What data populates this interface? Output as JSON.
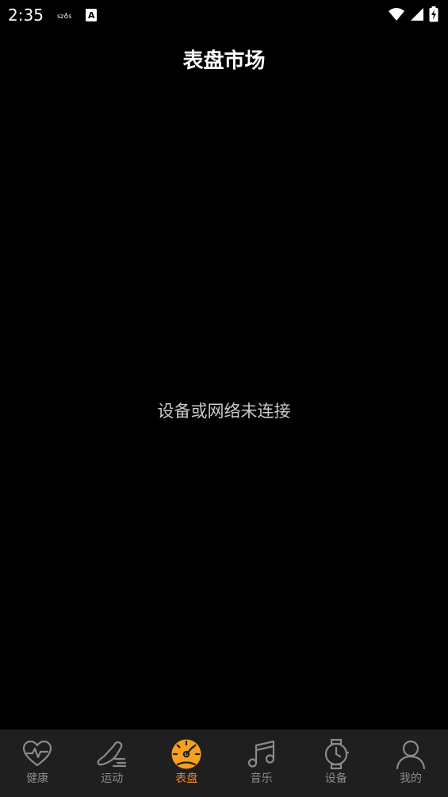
{
  "status_bar": {
    "time": "2:35",
    "notification_icons": [
      "sz-app-icon",
      "a-text-icon"
    ],
    "system_icons": [
      "wifi-icon",
      "signal-icon",
      "battery-charging-icon"
    ]
  },
  "header": {
    "title": "表盘市场"
  },
  "main": {
    "empty_message": "设备或网络未连接"
  },
  "tab_bar": {
    "active_color": "#f28a1e",
    "inactive_color": "#8a8a8a",
    "background": "#1f1f1f",
    "tabs": [
      {
        "label": "健康",
        "icon": "heart-pulse-icon",
        "active": false
      },
      {
        "label": "运动",
        "icon": "running-shoe-icon",
        "active": false
      },
      {
        "label": "表盘",
        "icon": "dial-gauge-icon",
        "active": true
      },
      {
        "label": "音乐",
        "icon": "music-note-icon",
        "active": false
      },
      {
        "label": "设备",
        "icon": "watch-icon",
        "active": false
      },
      {
        "label": "我的",
        "icon": "person-icon",
        "active": false
      }
    ]
  }
}
